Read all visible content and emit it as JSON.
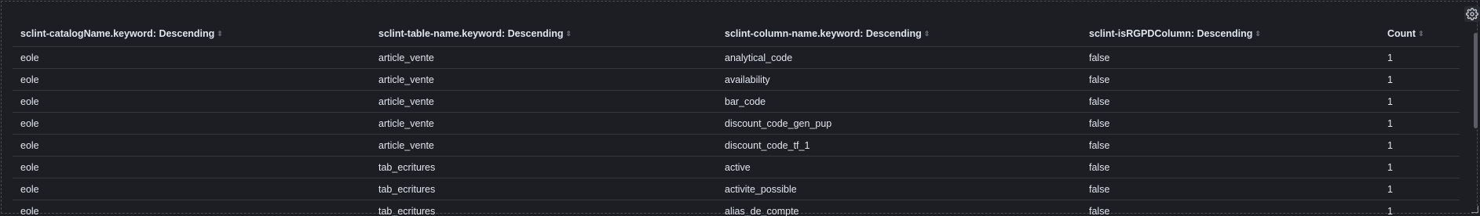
{
  "table": {
    "headers": [
      "sclint-catalogName.keyword: Descending",
      "sclint-table-name.keyword: Descending",
      "sclint-column-name.keyword: Descending",
      "sclint-isRGPDColumn: Descending",
      "Count"
    ],
    "rows": [
      [
        "eole",
        "article_vente",
        "analytical_code",
        "false",
        "1"
      ],
      [
        "eole",
        "article_vente",
        "availability",
        "false",
        "1"
      ],
      [
        "eole",
        "article_vente",
        "bar_code",
        "false",
        "1"
      ],
      [
        "eole",
        "article_vente",
        "discount_code_gen_pup",
        "false",
        "1"
      ],
      [
        "eole",
        "article_vente",
        "discount_code_tf_1",
        "false",
        "1"
      ],
      [
        "eole",
        "tab_ecritures",
        "active",
        "false",
        "1"
      ],
      [
        "eole",
        "tab_ecritures",
        "activite_possible",
        "false",
        "1"
      ],
      [
        "eole",
        "tab_ecritures",
        "alias_de_compte",
        "false",
        "1"
      ]
    ]
  },
  "icons": {
    "settings": "gear-icon",
    "sort": "sort-icon",
    "resize": "resize-handle-icon"
  },
  "colors": {
    "background": "#1d1e24",
    "text": "#dfe5ef",
    "border": "#343741"
  }
}
